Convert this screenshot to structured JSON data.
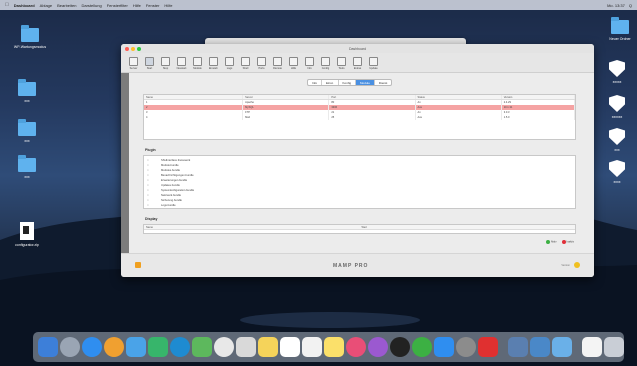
{
  "menubar": {
    "app": "Dashboard",
    "items": [
      "Ablage",
      "Bearbeiten",
      "Darstellung",
      "Fensterfilter",
      "Hilfe",
      "Fenster",
      "Hilfe"
    ],
    "right": [
      "Mo. 13:37",
      "Q"
    ]
  },
  "desktop": {
    "left_icons": [
      {
        "label": "WP-Wartungsmodus",
        "type": "folder"
      },
      {
        "label": "xxx",
        "type": "folder"
      },
      {
        "label": "xxx",
        "type": "folder"
      },
      {
        "label": "xxx",
        "type": "folder"
      },
      {
        "label": "configurator.zip",
        "type": "document"
      }
    ],
    "right_icons": [
      {
        "label": "Neuer Ordner",
        "type": "folder"
      },
      {
        "label": "xxxxx",
        "type": "shield"
      },
      {
        "label": "xxxxxx",
        "type": "shield"
      },
      {
        "label": "xxx",
        "type": "shield"
      },
      {
        "label": "xxxx",
        "type": "shield"
      }
    ]
  },
  "window": {
    "title": "Dashboard",
    "toolbar": [
      "Server",
      "Start",
      "Stop",
      "Neustart",
      "Module",
      "Einstell.",
      "Logs",
      "Shell",
      "Ports",
      "Dienste",
      "Hilfe",
      "Info",
      "Config",
      "Tools",
      "Extras",
      "Update"
    ],
    "tabs": [
      {
        "label": "Info",
        "active": false
      },
      {
        "label": "Einst.",
        "active": false
      },
      {
        "label": "Konfig",
        "active": false
      },
      {
        "label": "Module",
        "active": true
      },
      {
        "label": "Dienst",
        "active": false
      }
    ],
    "table": {
      "headers": [
        "Name",
        "Server",
        "Port",
        "Status",
        "Version"
      ],
      "rows": [
        {
          "cells": [
            "1",
            "Apache",
            "80",
            "An",
            "2.4.29"
          ],
          "highlight": false
        },
        {
          "cells": [
            "2",
            "MySQL",
            "3306",
            "Aus",
            "10.1.31"
          ],
          "highlight": true
        },
        {
          "cells": [
            "3",
            "FTP",
            "21",
            "An",
            "3.0.3"
          ],
          "highlight": false
        },
        {
          "cells": [
            "4",
            "Mail",
            "25",
            "Aus",
            "1.5.0"
          ],
          "highlight": false
        }
      ]
    },
    "plugins_label": "Plugin",
    "plugins": [
      "SSHInterface.framework",
      "Module.bundle",
      "Modules.bundle",
      "Benachrichtigungen.bundle",
      "Erweiterungen.bundle",
      "Updates.bundle",
      "Systemkonfiguration.bundle",
      "Netzwerk.bundle",
      "Sicherung.bundle",
      "Logs.bundle"
    ],
    "display_label": "Display",
    "display_headers": [
      "Name",
      "Wert"
    ],
    "legend": [
      {
        "label": "Aktiv",
        "color": "#3cb043"
      },
      {
        "label": "Inaktiv",
        "color": "#e0303a"
      }
    ],
    "brand": "MAMP PRO",
    "version": "Version"
  }
}
